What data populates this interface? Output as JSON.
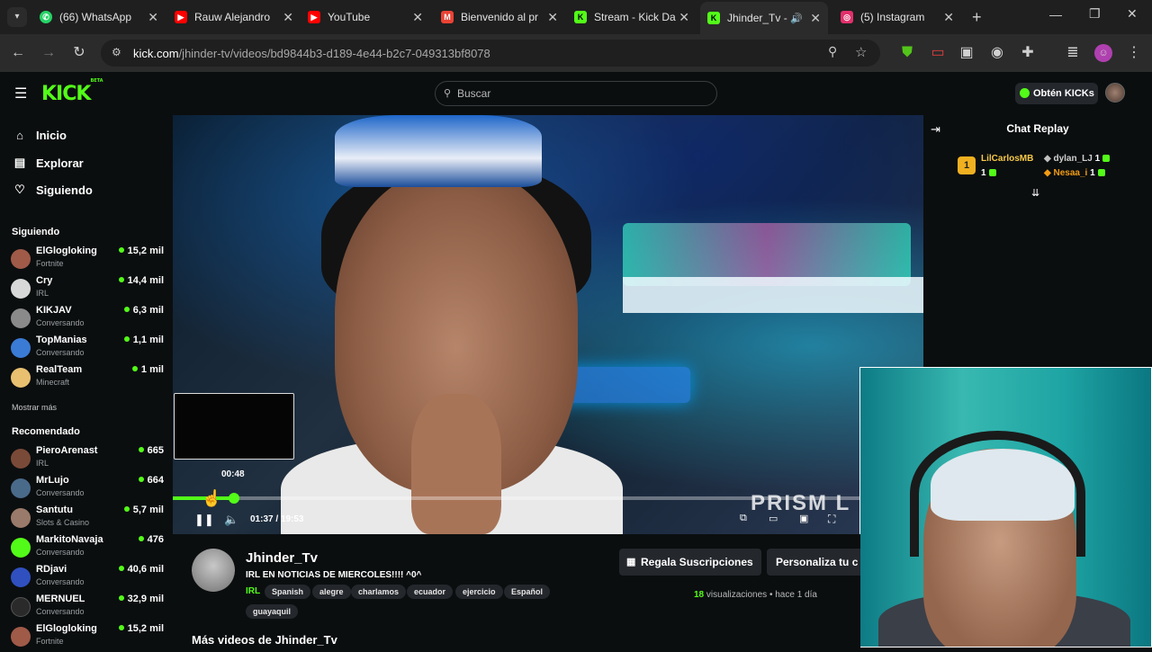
{
  "browser": {
    "tabs": [
      {
        "label": "(66) WhatsApp",
        "icon": "whatsapp-icon",
        "color": "#25d366"
      },
      {
        "label": "Rauw Alejandro",
        "icon": "youtube-icon",
        "color": "#ff0000"
      },
      {
        "label": "YouTube",
        "icon": "youtube-icon",
        "color": "#ff0000"
      },
      {
        "label": "Bienvenido al pr",
        "icon": "gmail-icon",
        "color": "#ea4335"
      },
      {
        "label": "Stream - Kick Da",
        "icon": "kick-icon",
        "color": "#53fc18"
      },
      {
        "label": "Jhinder_Tv -",
        "icon": "kick-icon",
        "color": "#53fc18"
      },
      {
        "label": "(5) Instagram",
        "icon": "instagram-icon",
        "color": "#e1306c"
      }
    ],
    "url_host": "kick.com",
    "url_path": "/jhinder-tv/videos/bd9844b3-d189-4e44-b2c7-049313bf8078"
  },
  "header": {
    "logo": "KICK",
    "logo_beta": "BETA",
    "search_placeholder": "Buscar",
    "get_kicks": "Obtén KICKs"
  },
  "sidebar": {
    "nav": [
      {
        "label": "Inicio",
        "icon": "home-icon"
      },
      {
        "label": "Explorar",
        "icon": "browse-icon"
      },
      {
        "label": "Siguiendo",
        "icon": "heart-icon"
      }
    ],
    "following_title": "Siguiendo",
    "following": [
      {
        "name": "ElGlogloking",
        "category": "Fortnite",
        "viewers": "15,2 mil",
        "color": "#a05a48"
      },
      {
        "name": "Cry",
        "category": "IRL",
        "viewers": "14,4 mil",
        "color": "#d8d8d8"
      },
      {
        "name": "KIKJAV",
        "category": "Conversando",
        "viewers": "6,3 mil",
        "color": "#8a8a8a"
      },
      {
        "name": "TopManias",
        "category": "Conversando",
        "viewers": "1,1 mil",
        "color": "#3a7bd5"
      },
      {
        "name": "RealTeam",
        "category": "Minecraft",
        "viewers": "1 mil",
        "color": "#e8c070"
      }
    ],
    "show_more": "Mostrar más",
    "recommended_title": "Recomendado",
    "recommended": [
      {
        "name": "PieroArenast",
        "category": "IRL",
        "viewers": "665",
        "color": "#7a4a38"
      },
      {
        "name": "MrLujo",
        "category": "Conversando",
        "viewers": "664",
        "color": "#4a6a8a"
      },
      {
        "name": "Santutu",
        "category": "Slots & Casino",
        "viewers": "5,7 mil",
        "color": "#9a7a6a"
      },
      {
        "name": "MarkitoNavaja",
        "category": "Conversando",
        "viewers": "476",
        "color": "#53fc18"
      },
      {
        "name": "RDjavi",
        "category": "Conversando",
        "viewers": "40,6 mil",
        "color": "#3050c0"
      },
      {
        "name": "MERNUEL",
        "category": "Conversando",
        "viewers": "32,9 mil",
        "color": "#2a2a2a"
      },
      {
        "name": "ElGlogloking",
        "category": "Fortnite",
        "viewers": "15,2 mil",
        "color": "#a05a48"
      }
    ]
  },
  "player": {
    "hover_time": "00:48",
    "current_time": "01:37",
    "duration": "19:53",
    "progress": 0.0813,
    "overlay_text": "PRISM L"
  },
  "chat": {
    "title": "Chat Replay",
    "users": [
      {
        "name": "LilCarlosMB",
        "count": "1",
        "color": "#f7c948"
      },
      {
        "name": "dylan_LJ",
        "count": "1",
        "color": "#d0d0d0"
      },
      {
        "name": "Nesaa_i",
        "count": "1",
        "color": "#f39c12"
      }
    ]
  },
  "channel": {
    "name": "Jhinder_Tv",
    "title": "IRL EN NOTICIAS DE MIERCOLES!!!! ^0^",
    "category": "IRL",
    "tags": [
      "Spanish",
      "alegre",
      "charlamos",
      "ecuador",
      "ejercicio",
      "Español",
      "guayaquil"
    ],
    "gift_button": "Regala Suscripciones",
    "customize_button": "Personaliza tu c",
    "views_count": "18",
    "views_label": "visualizaciones",
    "age": "hace 1 día",
    "more_videos": "Más videos de Jhinder_Tv"
  }
}
